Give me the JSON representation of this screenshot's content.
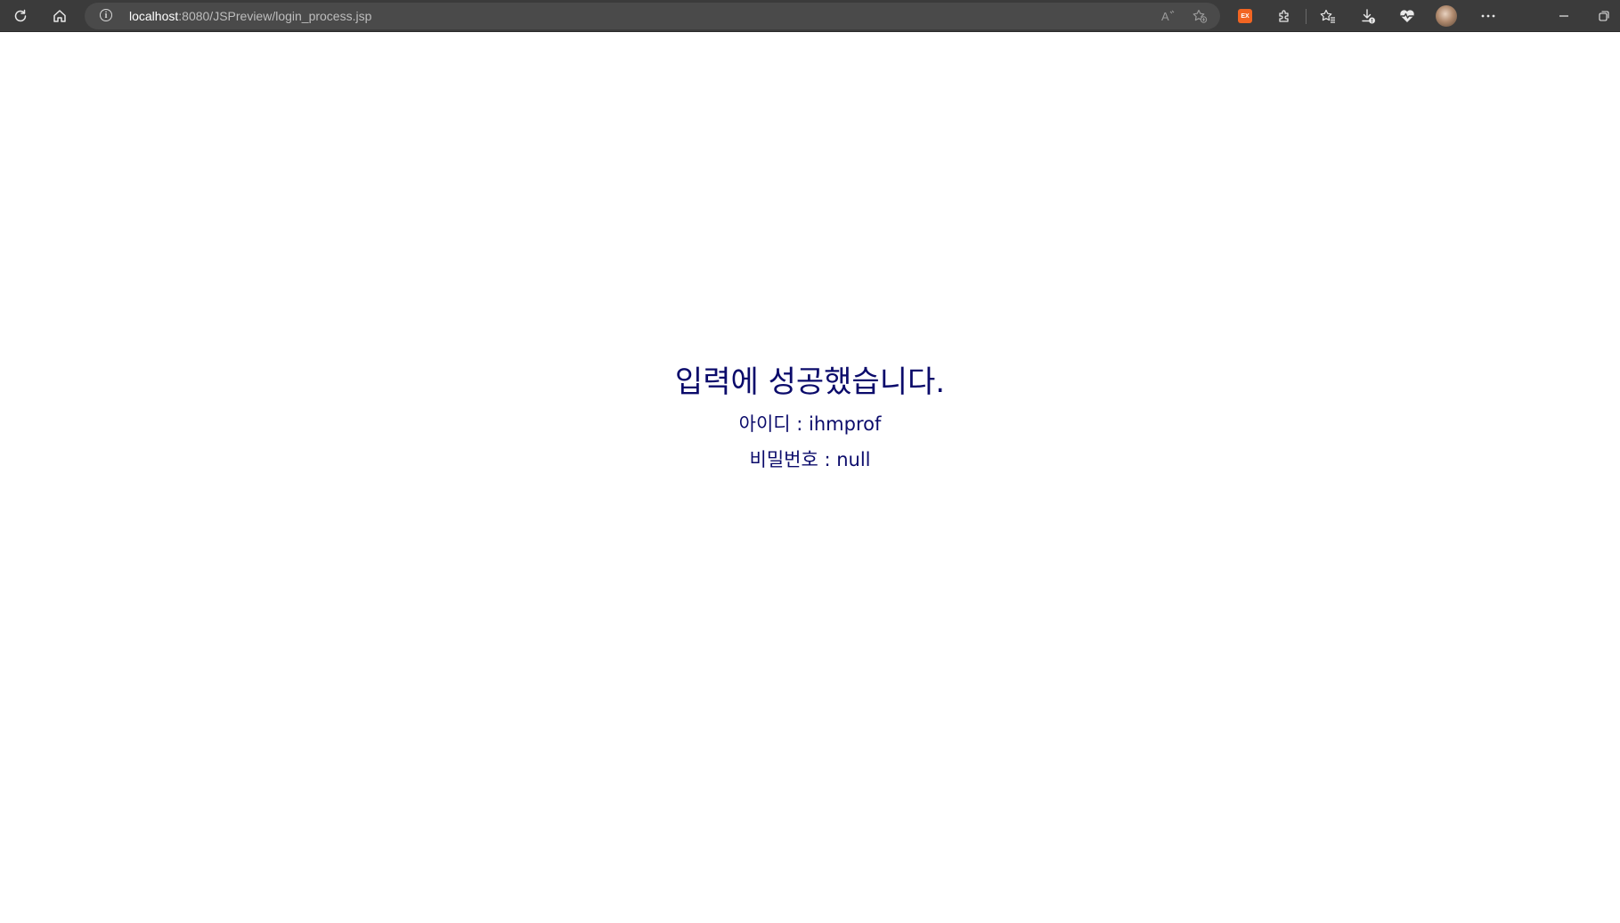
{
  "browser": {
    "url_host": "localhost",
    "url_path": ":8080/JSPreview/login_process.jsp",
    "extension_badge": "EX",
    "icons": {
      "refresh": "refresh-icon",
      "home": "home-icon",
      "site_info": "info-icon",
      "read_aloud": "read-aloud-icon",
      "add_favorite": "add-favorite-icon",
      "extensions": "puzzle-icon",
      "favorites": "favorites-icon",
      "downloads": "download-icon",
      "browser_essentials": "heart-pulse-icon",
      "more": "more-icon",
      "minimize": "minimize-icon",
      "restore": "restore-icon"
    },
    "colors": {
      "toolbar": "#3b3b3b",
      "address_bar": "#4a4a4a",
      "extension_badge": "#f26522"
    }
  },
  "page": {
    "heading": "입력에 성공했습니다.",
    "id_line": "아이디 : ihmprof",
    "password_line": "비밀번호 : null",
    "text_color": "#0b0b6b"
  }
}
